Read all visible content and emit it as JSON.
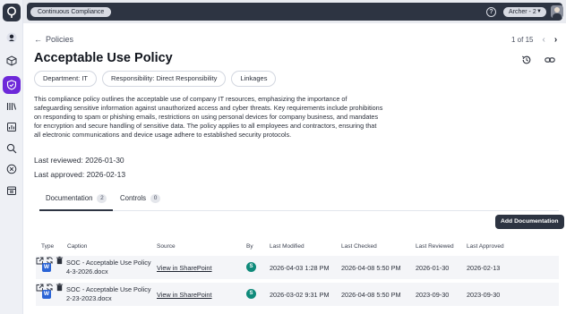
{
  "topbar": {
    "app_name": "Continuous Compliance",
    "help": "?",
    "user": "Archer - 2"
  },
  "nav": {
    "back_label": "Policies",
    "pager_text": "1 of 15"
  },
  "policy": {
    "title": "Acceptable Use Policy",
    "chips": [
      "Department: IT",
      "Responsibility: Direct Responsibility",
      "Linkages"
    ],
    "description": "This compliance policy outlines the acceptable use of company IT resources, emphasizing the importance of safeguarding sensitive information against unauthorized access and cyber threats. Key requirements include prohibitions on responding to spam or phishing emails, restrictions on using personal devices for company business, and mandates for encryption and secure handling of sensitive data. The policy applies to all employees and contractors, ensuring that all electronic communications and device usage adhere to established security protocols.",
    "last_reviewed": "Last reviewed: 2026-01-30",
    "last_approved": "Last approved: 2026-02-13"
  },
  "tabs": [
    {
      "label": "Documentation",
      "count": "2"
    },
    {
      "label": "Controls",
      "count": "0"
    }
  ],
  "add_button": "Add Documentation",
  "table": {
    "headers": [
      "Type",
      "Caption",
      "Source",
      "By",
      "Last Modified",
      "Last Checked",
      "Last Reviewed",
      "Last Approved"
    ],
    "rows": [
      {
        "type": "W",
        "caption": "SOC - Acceptable Use Policy 4-3-2026.docx",
        "source": "View in SharePoint",
        "by": "S",
        "last_modified": "2026-04-03 1:28 PM",
        "last_checked": "2026-04-08 5:50 PM",
        "last_reviewed": "2026-01-30",
        "last_approved": "2026-02-13"
      },
      {
        "type": "W",
        "caption": "SOC - Acceptable Use Policy 2-23-2023.docx",
        "source": "View in SharePoint",
        "by": "S",
        "last_modified": "2026-03-02 9:31 PM",
        "last_checked": "2026-04-08 5:50 PM",
        "last_reviewed": "2023-09-30",
        "last_approved": "2023-09-30"
      }
    ]
  },
  "colors": {
    "accent": "#6d28d9",
    "dark": "#2d3442",
    "word": "#2b64d6",
    "sharepoint": "#0f8a7a"
  }
}
